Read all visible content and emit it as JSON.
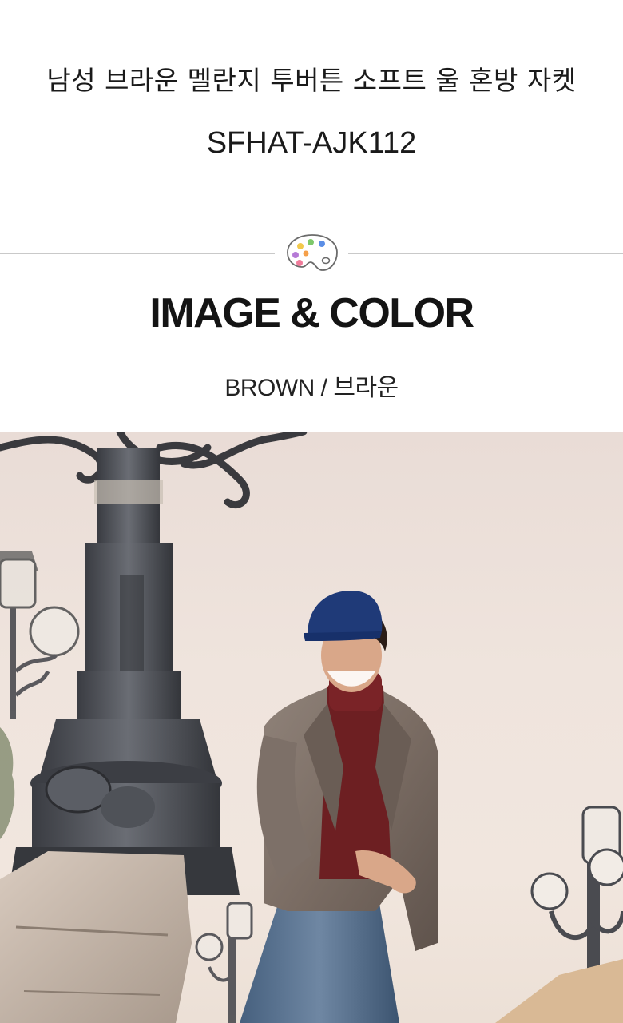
{
  "product": {
    "title": "남성 브라운 멜란지 투버튼 소프트 울 혼방 자켓",
    "code": "SFHAT-AJK112"
  },
  "section": {
    "heading": "IMAGE & COLOR",
    "color_label": "BROWN / 브라운"
  },
  "icons": {
    "palette": "palette-icon"
  },
  "colors": {
    "palette_dots": [
      "#f2c94c",
      "#7ec86b",
      "#5b8ee6",
      "#b57ad6",
      "#f07b9a",
      "#f5a04a"
    ],
    "divider": "#c9c9c9"
  }
}
